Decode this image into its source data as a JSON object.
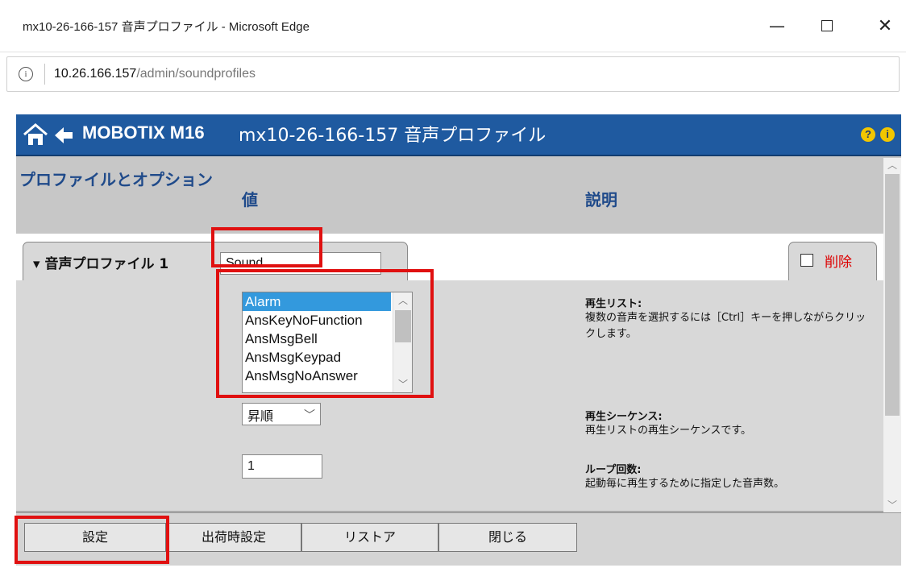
{
  "window": {
    "title": "mx10-26-166-157 音声プロファイル - Microsoft Edge",
    "minimize_glyph": "—",
    "close_glyph": "✕"
  },
  "addressbar": {
    "info_glyph": "i",
    "url_host": "10.26.166.157",
    "url_path": "/admin/soundprofiles"
  },
  "header": {
    "brand": "MOBOTIX M16",
    "subtitle": "mx10-26-166-157 音声プロファイル",
    "help_glyph": "?",
    "info_glyph": "i"
  },
  "columns": {
    "profile": "プロファイルとオプション",
    "value": "値",
    "description": "説明"
  },
  "profile1": {
    "label": "▾ 音声プロファイル 1",
    "name_value": "Sound",
    "delete_label": "削除",
    "playlist_options": [
      "Alarm",
      "AnsKeyNoFunction",
      "AnsMsgBell",
      "AnsMsgKeypad",
      "AnsMsgNoAnswer"
    ],
    "selected_option": "Alarm",
    "sequence_value": "昇順",
    "loop_value": "1"
  },
  "descriptions": {
    "playlist_title": "再生リスト:",
    "playlist_text": "複数の音声を選択するには［Ctrl］キーを押しながらクリックします。",
    "sequence_title": "再生シーケンス:",
    "sequence_text": "再生リストの再生シーケンスです。",
    "loop_title": "ループ回数:",
    "loop_text": "起動毎に再生するために指定した音声数。"
  },
  "footer": {
    "set": "設定",
    "factory": "出荷時設定",
    "restore": "リストア",
    "close": "閉じる"
  },
  "colors": {
    "header_blue": "#1f5aa0",
    "heading_text": "#1f4a8a",
    "selection": "#3399dd",
    "delete_red": "#dd0000",
    "annotation_red": "#e01010"
  }
}
